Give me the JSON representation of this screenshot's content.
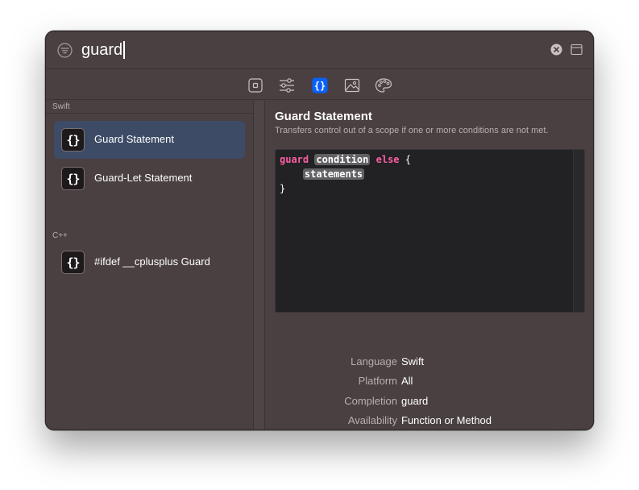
{
  "search": {
    "query": "guard"
  },
  "toolbar": {
    "tabs": [
      {
        "icon": "square-icon",
        "selected": false
      },
      {
        "icon": "sliders-icon",
        "selected": false
      },
      {
        "icon": "braces-icon",
        "selected": true
      },
      {
        "icon": "image-icon",
        "selected": false
      },
      {
        "icon": "palette-icon",
        "selected": false
      }
    ]
  },
  "results": {
    "sections": [
      {
        "label": "Swift",
        "items": [
          {
            "label": "Guard Statement",
            "icon": "{}",
            "selected": true
          },
          {
            "label": "Guard-Let Statement",
            "icon": "{}",
            "selected": false
          }
        ]
      },
      {
        "label": "C++",
        "items": [
          {
            "label": "#ifdef __cplusplus Guard",
            "icon": "{}",
            "selected": false
          }
        ]
      }
    ]
  },
  "detail": {
    "title": "Guard Statement",
    "summary": "Transfers control out of a scope if one or more conditions are not met.",
    "code": {
      "kw_guard": "guard",
      "ph_condition": "condition",
      "kw_else": "else",
      "brace_open": "{",
      "ph_statements": "statements",
      "brace_close": "}"
    },
    "meta": [
      {
        "key": "Language",
        "value": "Swift"
      },
      {
        "key": "Platform",
        "value": "All"
      },
      {
        "key": "Completion",
        "value": "guard"
      },
      {
        "key": "Availability",
        "value": "Function or Method"
      }
    ]
  },
  "colors": {
    "window_bg": "#4a4041",
    "selected_row": "#3d4b66",
    "accent": "#0a60ff",
    "keyword": "#fc5fa3"
  }
}
